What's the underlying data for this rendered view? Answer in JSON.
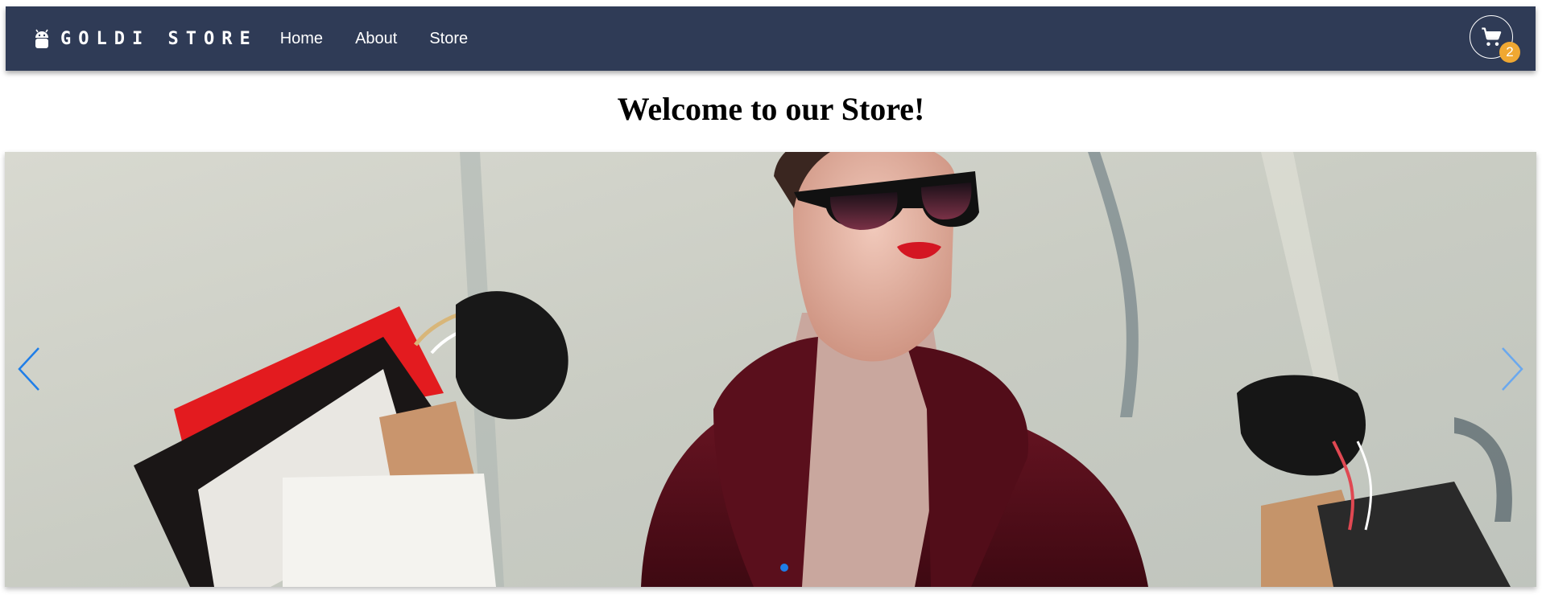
{
  "navbar": {
    "brand": "GOLDI STORE",
    "links": [
      {
        "label": "Home"
      },
      {
        "label": "About"
      },
      {
        "label": "Store"
      }
    ],
    "cart": {
      "count": "2",
      "icon": "cart-icon"
    }
  },
  "main": {
    "title": "Welcome to our Store!",
    "carousel": {
      "slide_count": 1,
      "active_slide": 1,
      "prev_icon": "chevron-left-icon",
      "next_icon": "chevron-right-icon"
    }
  },
  "colors": {
    "navbar": "#2f3b56",
    "badge": "#f0a832",
    "accent": "#1f7ee8"
  }
}
